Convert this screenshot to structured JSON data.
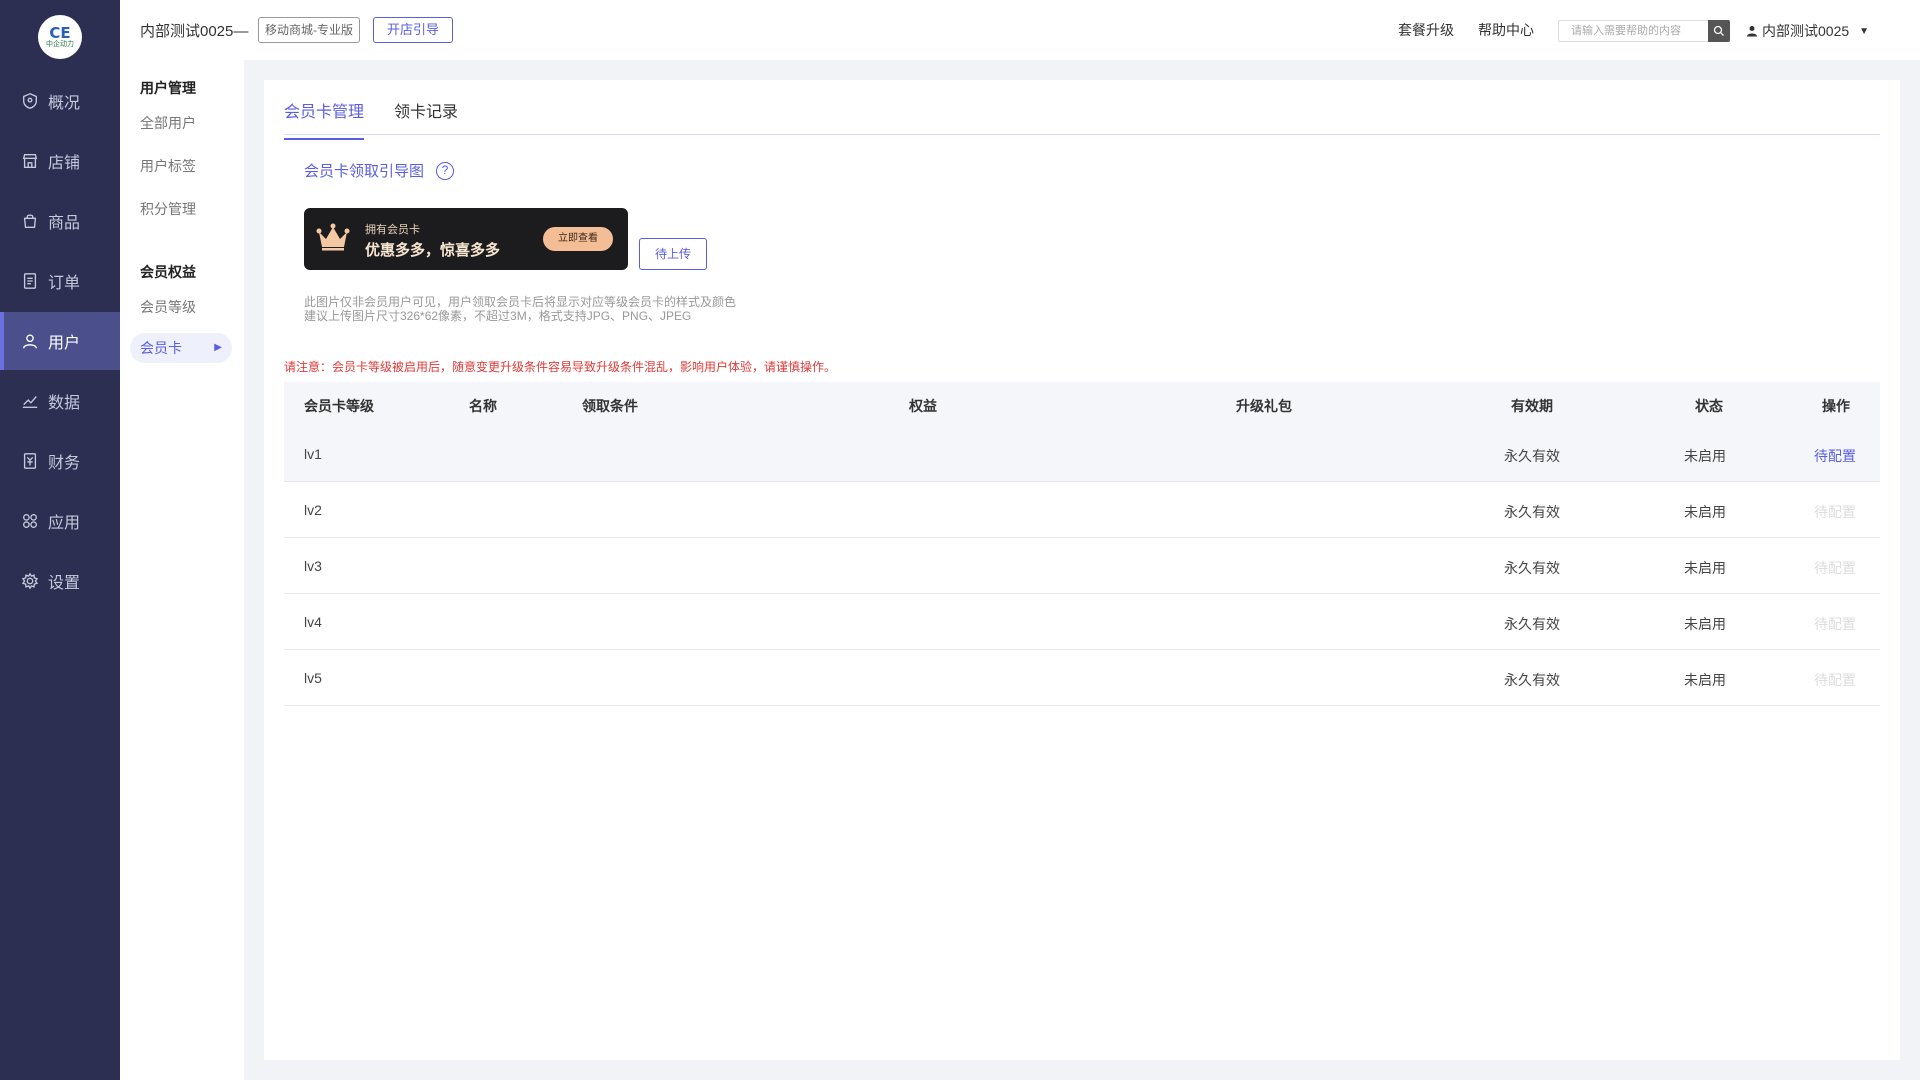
{
  "logo": {
    "mark": "CE",
    "text": "中企动力"
  },
  "nav": [
    {
      "label": "概况",
      "icon": "shield-icon"
    },
    {
      "label": "店铺",
      "icon": "store-icon"
    },
    {
      "label": "商品",
      "icon": "bag-icon"
    },
    {
      "label": "订单",
      "icon": "document-icon"
    },
    {
      "label": "用户",
      "icon": "user-icon",
      "active": true
    },
    {
      "label": "数据",
      "icon": "chart-icon"
    },
    {
      "label": "财务",
      "icon": "finance-icon"
    },
    {
      "label": "应用",
      "icon": "apps-icon"
    },
    {
      "label": "设置",
      "icon": "gear-icon"
    }
  ],
  "header": {
    "shop_name": "内部测试0025—",
    "edition": "移动商城-专业版",
    "guide_button": "开店引导",
    "upgrade_link": "套餐升级",
    "help_link": "帮助中心",
    "search_placeholder": "请输入需要帮助的内容",
    "user_name": "内部测试0025"
  },
  "sub_sidebar": {
    "group1_title": "用户管理",
    "group1_items": [
      "全部用户",
      "用户标签",
      "积分管理"
    ],
    "group2_title": "会员权益",
    "group2_items": [
      "会员等级",
      "会员卡"
    ]
  },
  "tabs": [
    "会员卡管理",
    "领卡记录"
  ],
  "guide": {
    "title": "会员卡领取引导图",
    "banner_line1": "拥有会员卡",
    "banner_line2": "优惠多多，惊喜多多",
    "banner_button": "立即查看",
    "upload_button": "待上传",
    "hint1": "此图片仅非会员用户可见，用户领取会员卡后将显示对应等级会员卡的样式及颜色",
    "hint2": "建议上传图片尺寸326*62像素，不超过3M，格式支持JPG、PNG、JPEG"
  },
  "warning": "请注意：会员卡等级被启用后，随意变更升级条件容易导致升级条件混乱，影响用户体验，请谨慎操作。",
  "table": {
    "headers": [
      "会员卡等级",
      "名称",
      "领取条件",
      "权益",
      "升级礼包",
      "有效期",
      "状态",
      "操作"
    ],
    "rows": [
      {
        "level": "lv1",
        "validity": "永久有效",
        "status": "未启用",
        "action": "待配置",
        "enabled": true
      },
      {
        "level": "lv2",
        "validity": "永久有效",
        "status": "未启用",
        "action": "待配置",
        "enabled": false
      },
      {
        "level": "lv3",
        "validity": "永久有效",
        "status": "未启用",
        "action": "待配置",
        "enabled": false
      },
      {
        "level": "lv4",
        "validity": "永久有效",
        "status": "未启用",
        "action": "待配置",
        "enabled": false
      },
      {
        "level": "lv5",
        "validity": "永久有效",
        "status": "未启用",
        "action": "待配置",
        "enabled": false
      }
    ]
  },
  "colors": {
    "accent": "#5a5ee0",
    "sidebar": "#2c2e52",
    "warning": "#e03a3a"
  }
}
